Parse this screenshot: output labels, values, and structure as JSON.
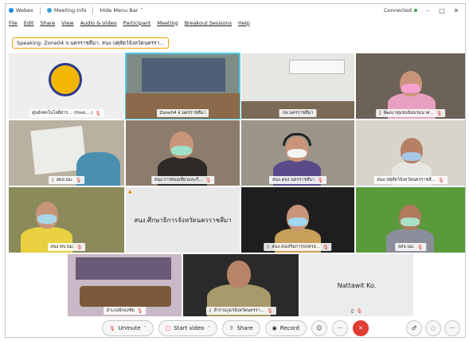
{
  "titlebar": {
    "app": "Webex",
    "meeting_info": "Meeting Info",
    "hide_menu": "Hide Menu Bar",
    "hide_caret": "˅",
    "connected": "Connected",
    "min": "–",
    "max": "□",
    "close": "✕"
  },
  "menu": [
    "File",
    "Edit",
    "Share",
    "View",
    "Audio & Video",
    "Participant",
    "Meeting",
    "Breakout Sessions",
    "Help"
  ],
  "speaking": "Speaking: Zone04 จ.นครราชสีมา, สนง.ปศุสัตว์จังหวัดนครรา...",
  "tiles": [
    {
      "label": "ศูนย์เทคโนโลยีสาร... (Host,...)"
    },
    {
      "label": "Zone04 จ.นครราชสีมา"
    },
    {
      "label": "กษ.นครราชสีมา"
    },
    {
      "label": "พัฒนาชุมชนนิยมรมนาศ..."
    },
    {
      "label": "สดอ.นม."
    },
    {
      "label": "สนง.การท่องเที่ยวและกี..."
    },
    {
      "label": "สนง.คลง.นครราชสีมา"
    },
    {
      "label": "สนง.ปศุสัตว์จังหวัดนครราชสี..."
    },
    {
      "label": "สนง.ทจ.นม."
    },
    {
      "label": "สนง.ศึกษาธิการจังหวัดนครราชสีมา"
    },
    {
      "label": "สนง.ส่งเสริมการปกครอ..."
    },
    {
      "label": "สสจ.นม."
    },
    {
      "label": "อำเภอปักธงชัย"
    },
    {
      "label": "สำรวจภูธรจังหวัดนครรา..."
    },
    {
      "label": "Nattawit Ko."
    }
  ],
  "toolbar": {
    "unmute": "Unmute",
    "start_video": "Start video",
    "share": "Share",
    "record": "Record",
    "emoji": "☺",
    "more": "···",
    "end": "✕",
    "caret": "˅",
    "participants": "♂",
    "chat": "◌",
    "more_right": "···"
  },
  "icons": {
    "mic_off": "🎙",
    "video_off": "▢",
    "share": "⇧",
    "record": "◉",
    "phone": "▯",
    "warn": "▲"
  },
  "colors": {
    "accent": "#4ec8e8",
    "end_red": "#e03c31",
    "speaking_border": "#f0a000"
  }
}
